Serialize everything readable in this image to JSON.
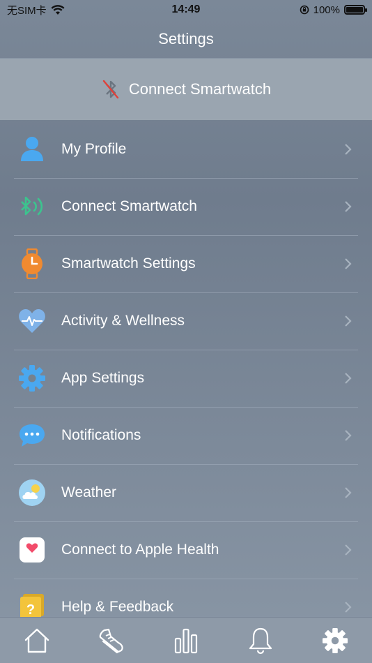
{
  "status_bar": {
    "carrier": "无SIM卡",
    "time": "14:49",
    "battery": "100%",
    "battery_level": 1.0
  },
  "header": {
    "title": "Settings"
  },
  "banner": {
    "label": "Connect Smartwatch",
    "icon": "bluetooth-disabled-icon"
  },
  "menu": {
    "items": [
      {
        "label": "My Profile",
        "icon": "person-icon"
      },
      {
        "label": "Connect Smartwatch",
        "icon": "bluetooth-signal-icon"
      },
      {
        "label": "Smartwatch Settings",
        "icon": "watch-icon"
      },
      {
        "label": "Activity & Wellness",
        "icon": "heart-pulse-icon"
      },
      {
        "label": "App Settings",
        "icon": "gear-icon"
      },
      {
        "label": "Notifications",
        "icon": "chat-bubble-icon"
      },
      {
        "label": "Weather",
        "icon": "weather-icon"
      },
      {
        "label": "Connect to Apple Health",
        "icon": "apple-health-icon"
      },
      {
        "label": "Help & Feedback",
        "icon": "help-icon"
      }
    ]
  },
  "tab_bar": {
    "tabs": [
      {
        "icon": "home-icon"
      },
      {
        "icon": "shoe-icon"
      },
      {
        "icon": "bar-chart-icon"
      },
      {
        "icon": "bell-icon"
      },
      {
        "icon": "gear-icon",
        "active": true
      }
    ]
  },
  "colors": {
    "accent_blue": "#4aa8f0",
    "bluetooth_green": "#3cc48e",
    "watch_orange": "#f08a30",
    "help_yellow": "#f3c43b",
    "health_pink": "#f24b6a"
  }
}
